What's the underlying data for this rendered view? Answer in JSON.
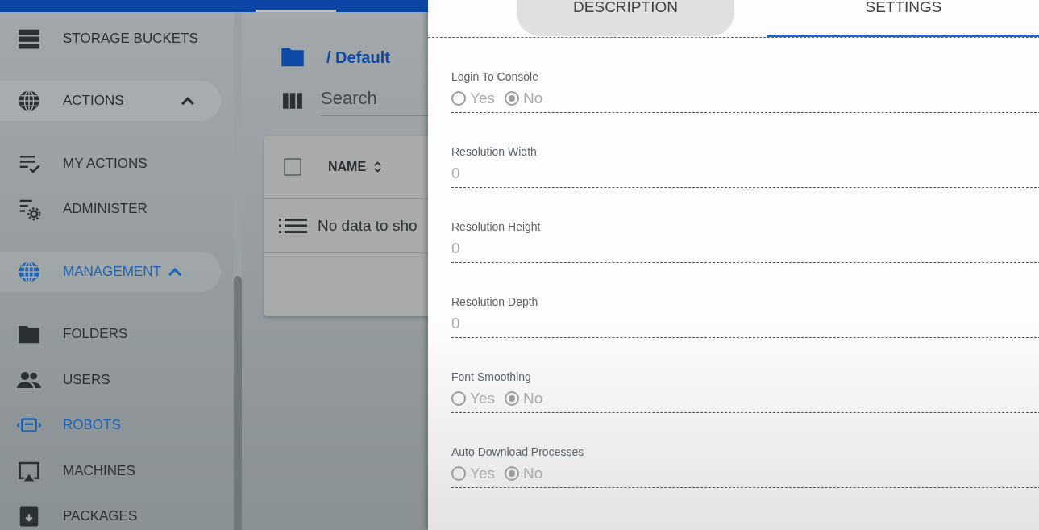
{
  "sidebar": {
    "items": [
      {
        "kind": "item",
        "label": "STORAGE BUCKETS",
        "selected": false
      },
      {
        "kind": "section",
        "label": "ACTIONS",
        "expanded": true,
        "selected": false
      },
      {
        "kind": "item",
        "label": "MY ACTIONS",
        "selected": false
      },
      {
        "kind": "item",
        "label": "ADMINISTER",
        "selected": false
      },
      {
        "kind": "section",
        "label": "MANAGEMENT",
        "expanded": true,
        "selected": true
      },
      {
        "kind": "item",
        "label": "FOLDERS",
        "selected": false
      },
      {
        "kind": "item",
        "label": "USERS",
        "selected": false
      },
      {
        "kind": "item",
        "label": "ROBOTS",
        "selected": true
      },
      {
        "kind": "item",
        "label": "MACHINES",
        "selected": false
      },
      {
        "kind": "item",
        "label": "PACKAGES",
        "selected": false
      }
    ]
  },
  "content": {
    "breadcrumb": "/ Default",
    "search": {
      "placeholder": "Search"
    },
    "table": {
      "columns": [
        {
          "label": "NAME"
        }
      ],
      "select_all": {
        "checked": false
      },
      "empty_message": "No data to sho"
    }
  },
  "panel": {
    "tabs": [
      {
        "label": "DESCRIPTION",
        "selected": false
      },
      {
        "label": "SETTINGS",
        "selected": true
      }
    ],
    "fields": [
      {
        "kind": "radio",
        "label": "Login To Console",
        "options": [
          {
            "label": "Yes",
            "selected": false
          },
          {
            "label": "No",
            "selected": true
          }
        ]
      },
      {
        "kind": "number",
        "label": "Resolution Width",
        "value": "0"
      },
      {
        "kind": "number",
        "label": "Resolution Height",
        "value": "0"
      },
      {
        "kind": "number",
        "label": "Resolution Depth",
        "value": "0"
      },
      {
        "kind": "radio",
        "label": "Font Smoothing",
        "options": [
          {
            "label": "Yes",
            "selected": false
          },
          {
            "label": "No",
            "selected": true
          }
        ]
      },
      {
        "kind": "radio",
        "label": "Auto Download Processes",
        "options": [
          {
            "label": "Yes",
            "selected": false
          },
          {
            "label": "No",
            "selected": true
          }
        ]
      }
    ]
  }
}
